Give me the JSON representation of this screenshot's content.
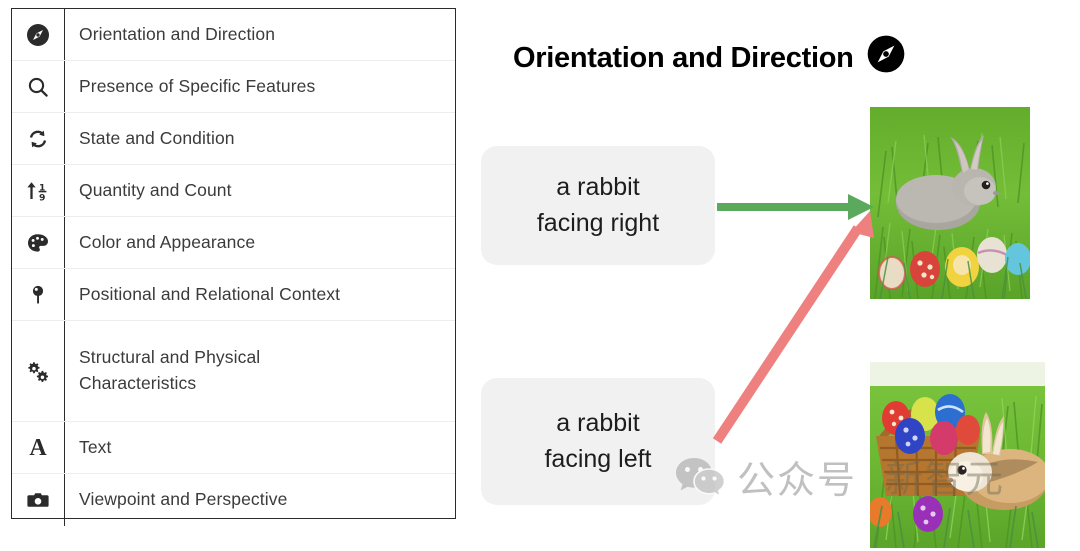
{
  "table": {
    "rows": [
      {
        "icon": "compass-icon",
        "label": "Orientation and Direction"
      },
      {
        "icon": "search-icon",
        "label": "Presence of Specific Features"
      },
      {
        "icon": "refresh-icon",
        "label": "State and Condition"
      },
      {
        "icon": "sort-numeric-icon",
        "label": "Quantity and Count"
      },
      {
        "icon": "palette-icon",
        "label": "Color and Appearance"
      },
      {
        "icon": "map-pin-icon",
        "label": "Positional and Relational Context"
      },
      {
        "icon": "gears-icon",
        "label": "Structural and Physical Characteristics"
      },
      {
        "icon": "letter-a-icon",
        "label": "Text"
      },
      {
        "icon": "camera-icon",
        "label": "Viewpoint and Perspective"
      }
    ]
  },
  "panel": {
    "title": "Orientation and Direction",
    "title_icon": "compass-icon",
    "captions": [
      {
        "line1": "a rabbit",
        "line2": "facing right"
      },
      {
        "line1": "a rabbit",
        "line2": "facing left"
      }
    ],
    "photos": [
      {
        "alt": "gray rabbit facing right in grass with colored easter eggs"
      },
      {
        "alt": "tan rabbit facing left beside a basket of colored easter eggs in grass"
      }
    ],
    "arrows": [
      {
        "name": "match-arrow",
        "color": "#5aa95c",
        "from": "caption-top",
        "to": "photo-top"
      },
      {
        "name": "mismatch-arrow",
        "color": "#ef8080",
        "from": "caption-bottom",
        "to": "photo-top"
      }
    ]
  },
  "watermark": {
    "logo": "wechat-icon",
    "text": "公众号",
    "text2": "新智元"
  },
  "colors": {
    "table_border": "#2b2b2b",
    "row_divider": "#ededed",
    "label_text": "#3b3b3b",
    "caption_bg": "#f1f1f1",
    "green_arrow": "#5aa95c",
    "red_arrow": "#ef8080"
  }
}
